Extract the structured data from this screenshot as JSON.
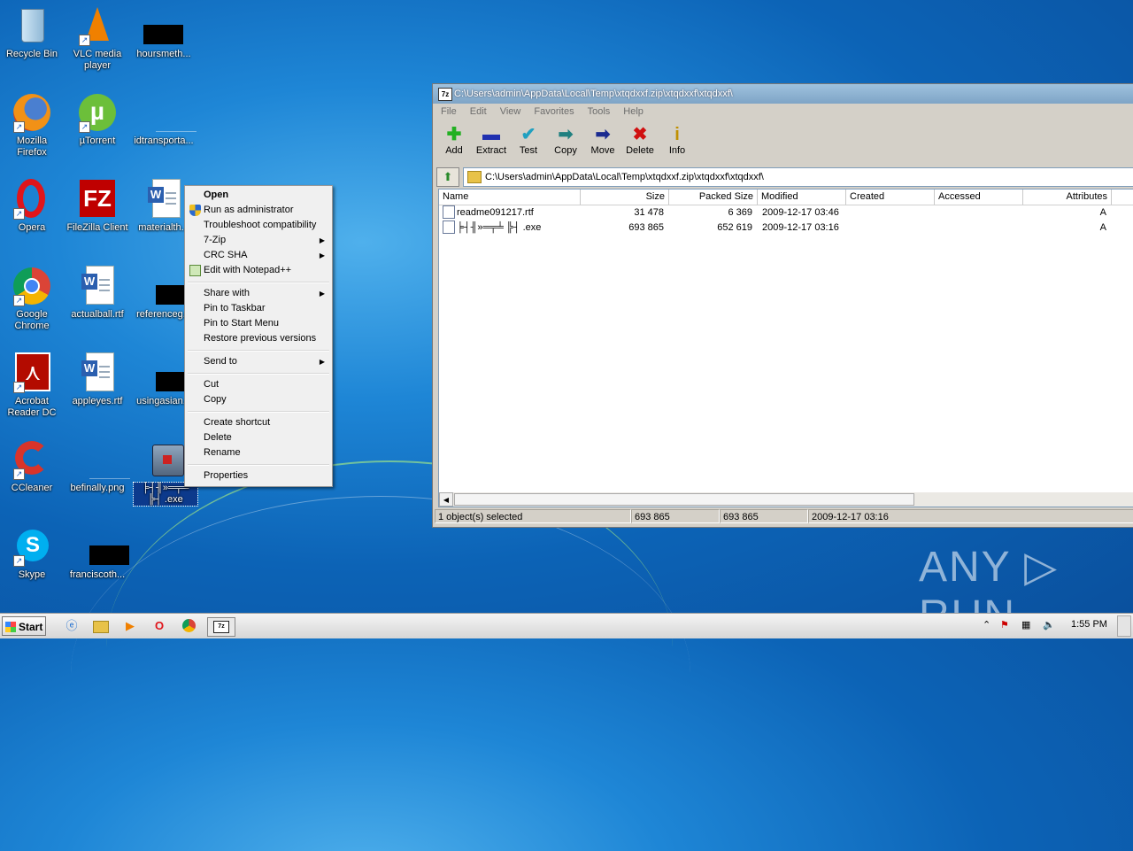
{
  "desktop": {
    "icons": [
      {
        "label": "Recycle Bin",
        "icon": "recycle-bin-icon"
      },
      {
        "label": "VLC media player",
        "icon": "vlc-icon"
      },
      {
        "label": "hoursmeth...",
        "icon": "black-thumbnail-icon"
      },
      {
        "label": "Mozilla Firefox",
        "icon": "firefox-icon"
      },
      {
        "label": "µTorrent",
        "icon": "utorrent-icon"
      },
      {
        "label": "idtransporta...",
        "icon": "blank-file-icon"
      },
      {
        "label": "Opera",
        "icon": "opera-icon"
      },
      {
        "label": "FileZilla Client",
        "icon": "filezilla-icon"
      },
      {
        "label": "materialth...",
        "icon": "word-doc-icon"
      },
      {
        "label": "Google Chrome",
        "icon": "chrome-icon"
      },
      {
        "label": "actualball.rtf",
        "icon": "word-doc-icon"
      },
      {
        "label": "referenceg...",
        "icon": "black-thumbnail-icon"
      },
      {
        "label": "Acrobat Reader DC",
        "icon": "acrobat-icon"
      },
      {
        "label": "appleyes.rtf",
        "icon": "word-doc-icon"
      },
      {
        "label": "usingasian...",
        "icon": "black-thumbnail-icon"
      },
      {
        "label": "CCleaner",
        "icon": "ccleaner-icon"
      },
      {
        "label": "befinally.png",
        "icon": "blank-file-icon"
      },
      {
        "label": "╞┤╢»═╤╧ ╠┤ .exe",
        "icon": "exe-icon"
      },
      {
        "label": "Skype",
        "icon": "skype-icon"
      },
      {
        "label": "franciscoth...",
        "icon": "black-thumbnail-icon"
      }
    ]
  },
  "context_menu": {
    "items": [
      {
        "label": "Open",
        "bold": true
      },
      {
        "label": "Run as administrator",
        "icon": "uac-shield-icon"
      },
      {
        "label": "Troubleshoot compatibility"
      },
      {
        "label": "7-Zip",
        "submenu": true
      },
      {
        "label": "CRC SHA",
        "submenu": true
      },
      {
        "label": "Edit with Notepad++",
        "icon": "notepadpp-icon"
      },
      {
        "label": "Share with",
        "submenu": true
      },
      {
        "label": "Pin to Taskbar"
      },
      {
        "label": "Pin to Start Menu"
      },
      {
        "label": "Restore previous versions"
      },
      {
        "label": "Send to",
        "submenu": true
      },
      {
        "label": "Cut"
      },
      {
        "label": "Copy"
      },
      {
        "label": "Create shortcut"
      },
      {
        "label": "Delete"
      },
      {
        "label": "Rename"
      },
      {
        "label": "Properties"
      }
    ]
  },
  "window": {
    "title": "C:\\Users\\admin\\AppData\\Local\\Temp\\xtqdxxf.zip\\xtqdxxf\\xtqdxxf\\",
    "app_icon": "7z",
    "menu": [
      "File",
      "Edit",
      "View",
      "Favorites",
      "Tools",
      "Help"
    ],
    "toolbar": [
      {
        "label": "Add",
        "glyph": "✚",
        "color": "#22b022"
      },
      {
        "label": "Extract",
        "glyph": "▬",
        "color": "#2030b0"
      },
      {
        "label": "Test",
        "glyph": "✔",
        "color": "#20a0c0"
      },
      {
        "label": "Copy",
        "glyph": "➡",
        "color": "#208080"
      },
      {
        "label": "Move",
        "glyph": "➡",
        "color": "#1a2a90"
      },
      {
        "label": "Delete",
        "glyph": "✖",
        "color": "#d01010"
      },
      {
        "label": "Info",
        "glyph": "i",
        "color": "#c09000"
      }
    ],
    "address": "C:\\Users\\admin\\AppData\\Local\\Temp\\xtqdxxf.zip\\xtqdxxf\\xtqdxxf\\",
    "columns": [
      "Name",
      "Size",
      "Packed Size",
      "Modified",
      "Created",
      "Accessed",
      "Attributes"
    ],
    "rows": [
      {
        "name": "readme091217.rtf",
        "size": "31 478",
        "packed": "6 369",
        "modified": "2009-12-17 03:46",
        "attributes": "A",
        "icon": "rtf-file-icon"
      },
      {
        "name": "╞┤╢»═╤╧ ╠┤ .exe",
        "size": "693 865",
        "packed": "652 619",
        "modified": "2009-12-17 03:16",
        "attributes": "A",
        "icon": "exe-file-icon"
      }
    ],
    "status": [
      "1 object(s) selected",
      "693 865",
      "693 865",
      "2009-12-17 03:16"
    ]
  },
  "taskbar": {
    "start_label": "Start",
    "apps": [
      "ie-icon",
      "explorer-icon",
      "media-player-icon",
      "opera-icon",
      "chrome-icon",
      "7zip-icon"
    ],
    "clock": "1:55 PM"
  },
  "watermark": "ANY ▷ RUN"
}
